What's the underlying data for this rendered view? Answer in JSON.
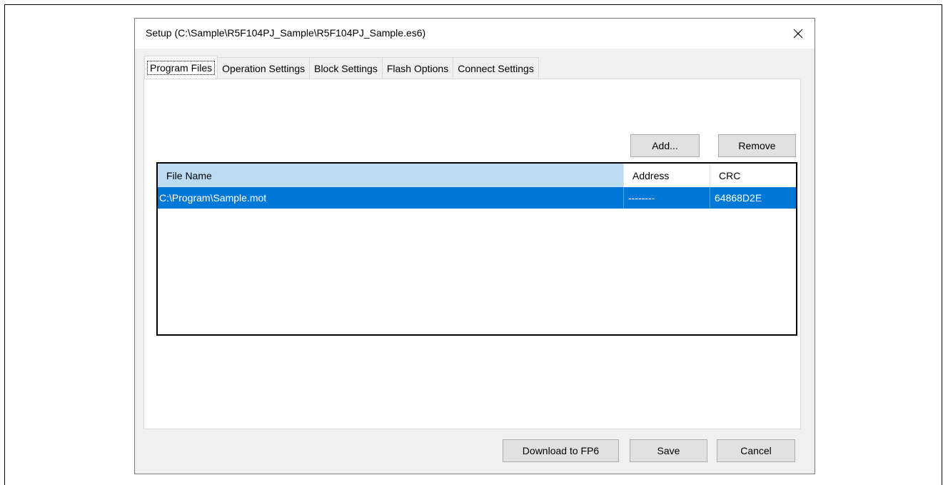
{
  "window": {
    "title": "Setup (C:\\Sample\\R5F104PJ_Sample\\R5F104PJ_Sample.es6)"
  },
  "tabs": [
    {
      "label": "Program Files",
      "active": true
    },
    {
      "label": "Operation Settings",
      "active": false
    },
    {
      "label": "Block Settings",
      "active": false
    },
    {
      "label": "Flash Options",
      "active": false
    },
    {
      "label": "Connect Settings",
      "active": false
    }
  ],
  "program_files": {
    "add_label": "Add...",
    "remove_label": "Remove",
    "columns": [
      "File Name",
      "Address",
      "CRC"
    ],
    "rows": [
      {
        "file_name": "C:\\Program\\Sample.mot",
        "address": "--------",
        "crc": "64868D2E",
        "selected": true
      }
    ]
  },
  "footer": {
    "download_label": "Download to FP6",
    "save_label": "Save",
    "cancel_label": "Cancel"
  },
  "colors": {
    "selection": "#0078d7",
    "sorted_header": "#bcdcf4",
    "dialog_bg": "#f0f0f0"
  }
}
